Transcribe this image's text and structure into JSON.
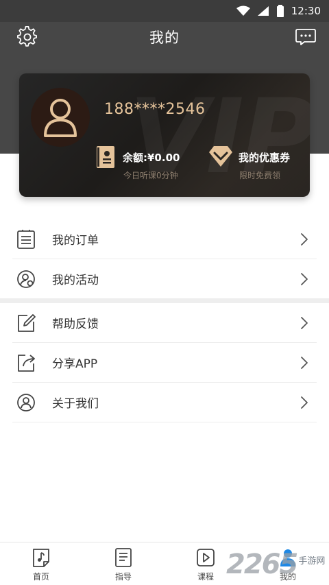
{
  "status_bar": {
    "time": "12:30"
  },
  "header": {
    "title": "我的"
  },
  "vip_card": {
    "watermark": "VIP",
    "phone": "188****2546",
    "balance_label": "余额:¥0.00",
    "balance_sub": "今日听课0分钟",
    "coupon_label": "我的优惠券",
    "coupon_sub": "限时免费领"
  },
  "menu_group_1": [
    {
      "label": "我的订单",
      "icon": "list-icon"
    },
    {
      "label": "我的活动",
      "icon": "activity-icon"
    }
  ],
  "menu_group_2": [
    {
      "label": "帮助反馈",
      "icon": "edit-icon"
    },
    {
      "label": "分享APP",
      "icon": "share-icon"
    },
    {
      "label": "关于我们",
      "icon": "user-circle-icon"
    }
  ],
  "tabs": [
    {
      "label": "首页",
      "icon": "music-doc-icon"
    },
    {
      "label": "指导",
      "icon": "guide-doc-icon"
    },
    {
      "label": "课程",
      "icon": "play-icon"
    },
    {
      "label": "我的",
      "icon": "profile-icon"
    }
  ],
  "watermark_logo": {
    "number": "2265",
    "text": "手游网"
  },
  "colors": {
    "gold": "#e5c39a",
    "header_bg": "#474747",
    "status_bg": "#3c3c3c"
  }
}
